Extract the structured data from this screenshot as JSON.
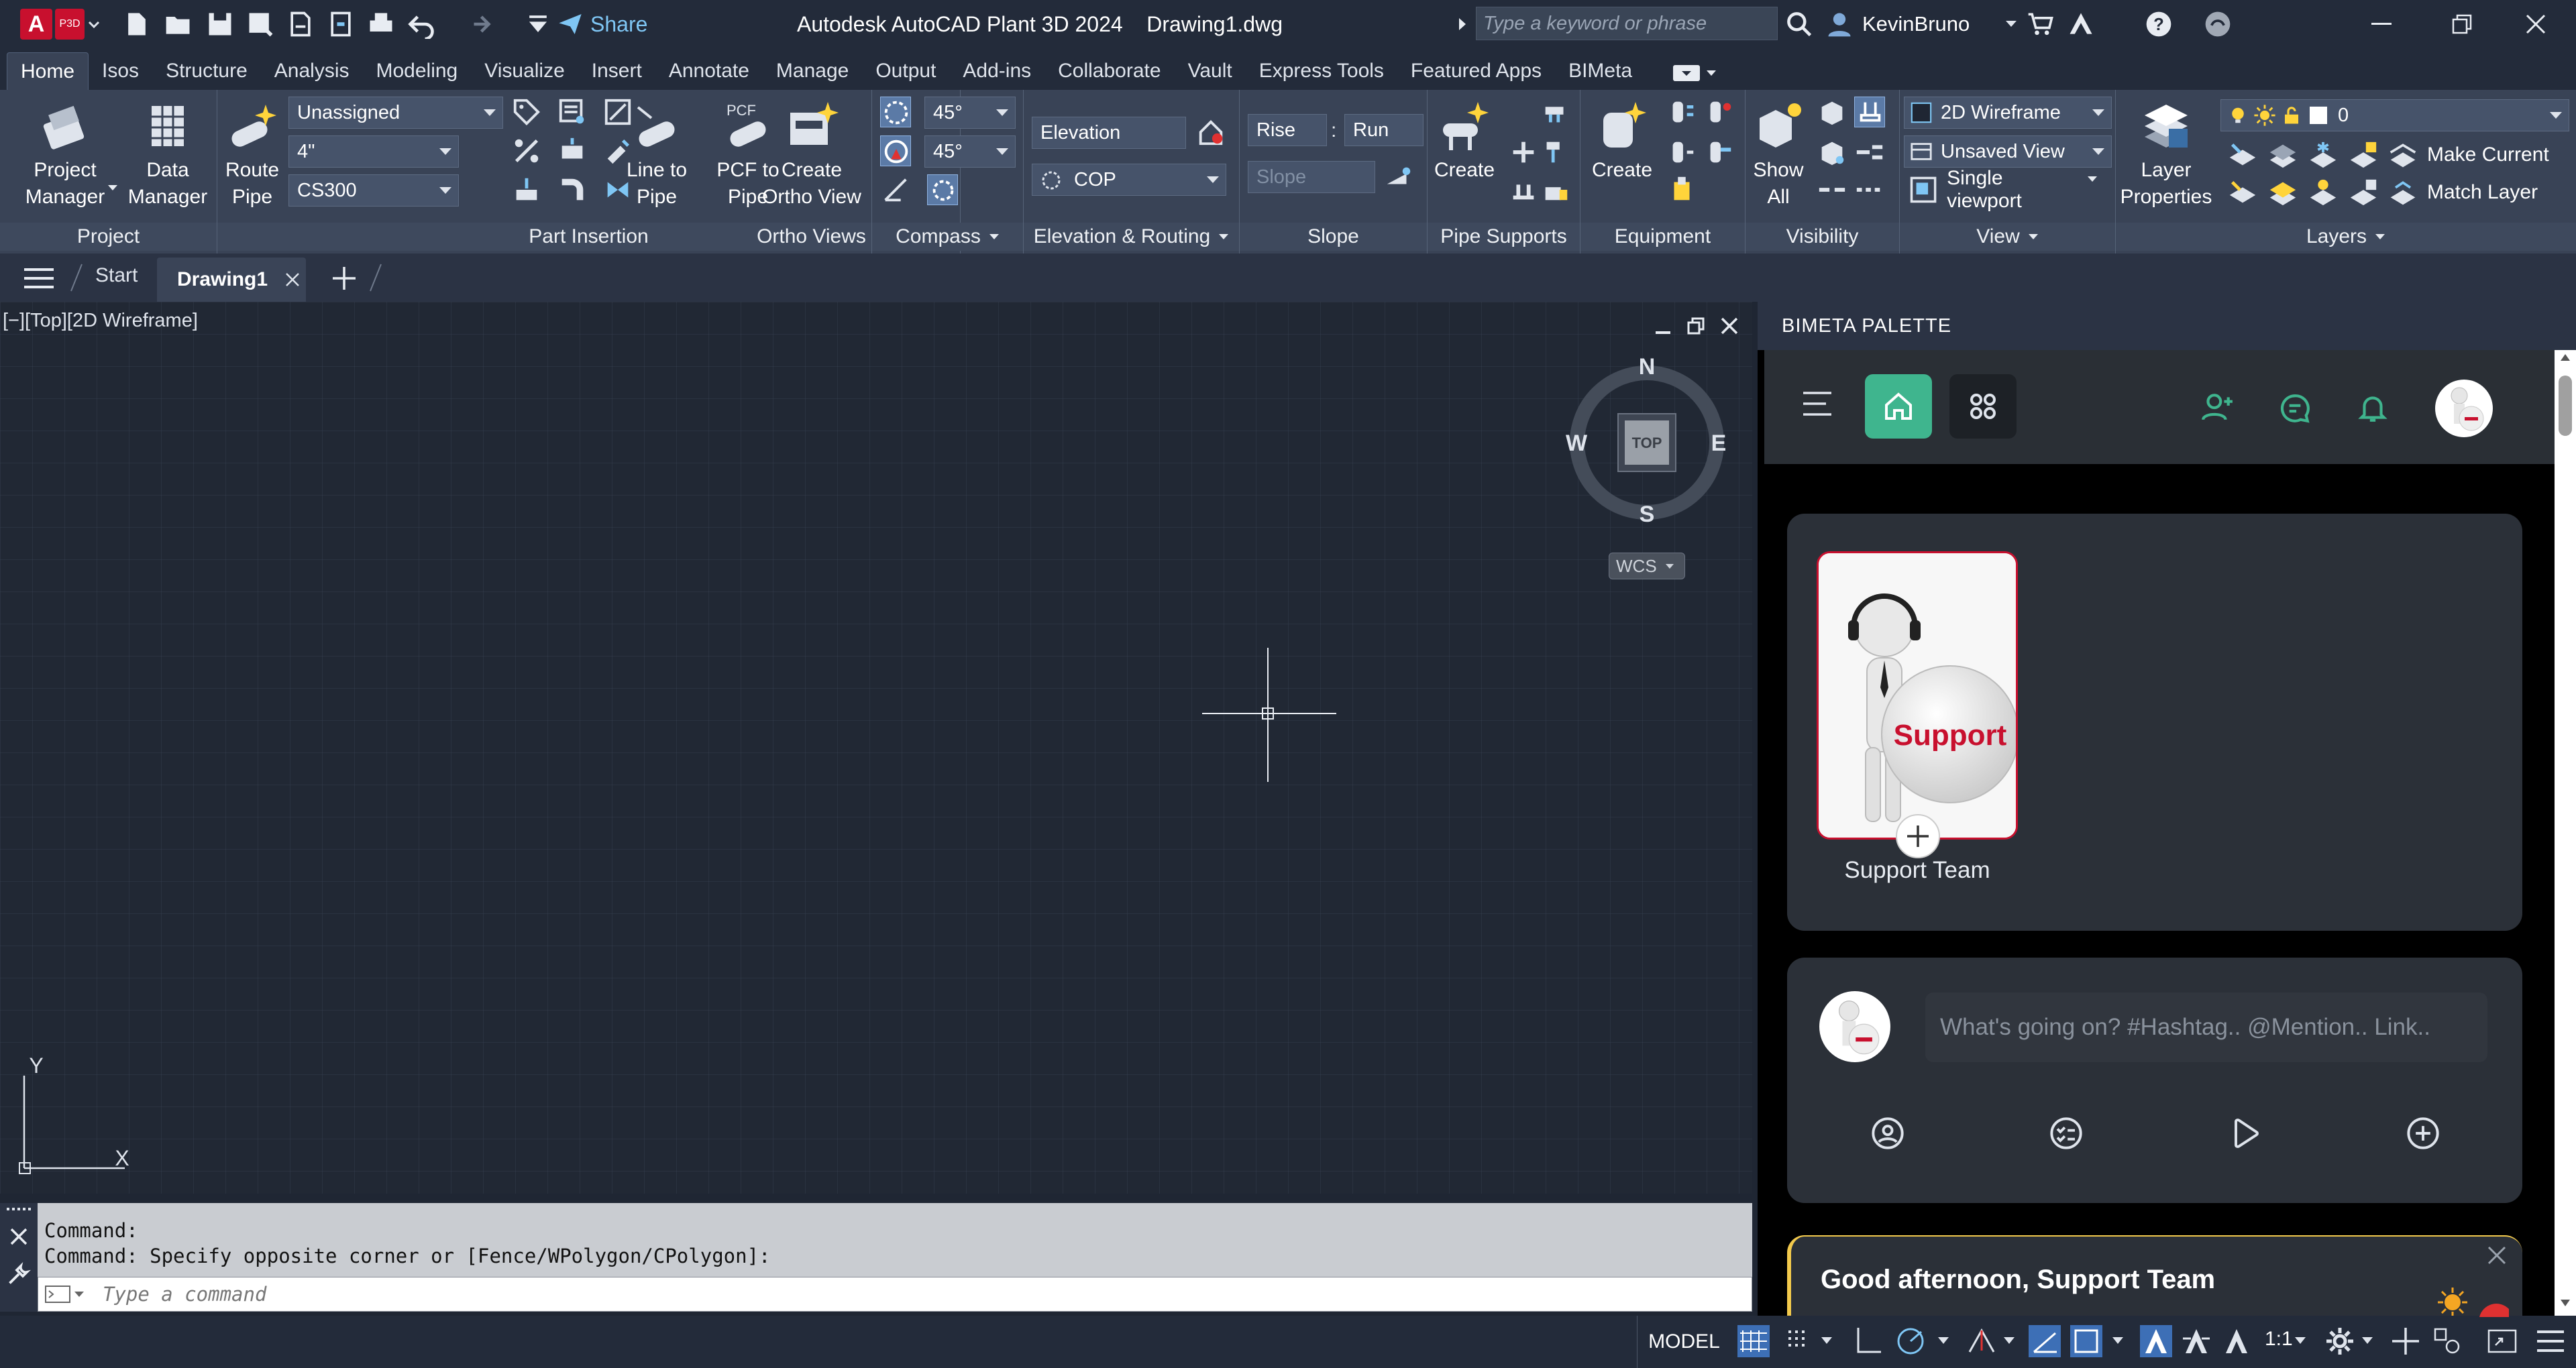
{
  "titlebar": {
    "app_badge": "A",
    "app_badge_sub": "P3D",
    "share_label": "Share",
    "app_title": "Autodesk AutoCAD Plant 3D 2024",
    "doc_title": "Drawing1.dwg",
    "search_placeholder": "Type a keyword or phrase",
    "username": "KevinBruno"
  },
  "ribbon_tabs": [
    "Home",
    "Isos",
    "Structure",
    "Analysis",
    "Modeling",
    "Visualize",
    "Insert",
    "Annotate",
    "Manage",
    "Output",
    "Add-ins",
    "Collaborate",
    "Vault",
    "Express Tools",
    "Featured Apps",
    "BIMeta"
  ],
  "ribbon": {
    "project": {
      "title": "Project",
      "project_manager": [
        "Project",
        "Manager"
      ],
      "data_manager": [
        "Data",
        "Manager"
      ]
    },
    "part_insertion": {
      "title": "Part Insertion",
      "route_pipe": [
        "Route",
        "Pipe"
      ],
      "line_to_pipe": [
        "Line to",
        "Pipe"
      ],
      "pcf_to_pipe": [
        "PCF to",
        "Pipe"
      ],
      "pcf_badge": "PCF",
      "spec_combo": "Unassigned",
      "size_combo": "4\"",
      "material_combo": "CS300"
    },
    "ortho_views": {
      "title": "Ortho Views",
      "create_ortho": [
        "Create",
        "Ortho View"
      ]
    },
    "compass": {
      "title": "Compass",
      "angle1": "45°",
      "angle2": "45°"
    },
    "elevation_routing": {
      "title": "Elevation & Routing",
      "elevation_field": "Elevation",
      "cop_combo": "COP"
    },
    "slope": {
      "title": "Slope",
      "rise_field": "Rise",
      "run_field": "Run",
      "separator": ":",
      "slope_field": "Slope"
    },
    "pipe_supports": {
      "title": "Pipe Supports",
      "create_label": "Create"
    },
    "equipment": {
      "title": "Equipment",
      "create_label": "Create"
    },
    "visibility": {
      "title": "Visibility",
      "show_all": [
        "Show",
        "All"
      ]
    },
    "view": {
      "title": "View",
      "visual_style": "2D Wireframe",
      "named_view": "Unsaved View",
      "viewport": "Single viewport"
    },
    "layers": {
      "title": "Layers",
      "layer_properties": [
        "Layer",
        "Properties"
      ],
      "layer_combo": "0",
      "make_current": "Make Current",
      "match_layer": "Match Layer"
    }
  },
  "file_tabs": {
    "start": "Start",
    "drawing1": "Drawing1"
  },
  "viewport": {
    "label": "[−][Top][2D Wireframe]",
    "viewcube": {
      "north": "N",
      "south": "S",
      "east": "E",
      "west": "W",
      "face": "TOP",
      "wcs": "WCS"
    },
    "ucs": {
      "x": "X",
      "y": "Y"
    }
  },
  "command": {
    "history": [
      "Command:",
      "Command: Specify opposite corner or [Fence/WPolygon/CPolygon]:"
    ],
    "placeholder": "Type a command"
  },
  "statusbar": {
    "model": "MODEL",
    "scale": "1:1"
  },
  "palette": {
    "header": "BIMETA PALETTE",
    "card_image_text": "Support",
    "card_name": "Support Team",
    "post_placeholder": "What's going on? #Hashtag.. @Mention.. Link..",
    "greeting": "Good afternoon, Support Team",
    "accent_color": "#3fb58e"
  }
}
